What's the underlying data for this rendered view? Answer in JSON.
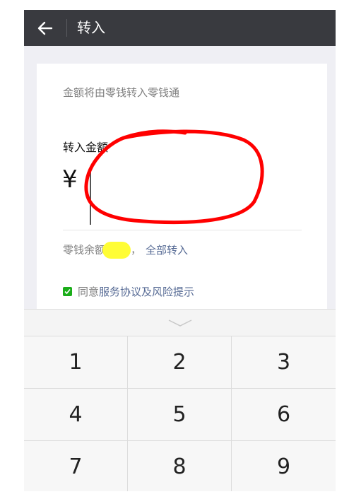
{
  "header": {
    "title": "转入"
  },
  "card": {
    "hint": "金额将由零钱转入零钱通",
    "amount_label": "转入金额",
    "currency_symbol": "¥",
    "amount_value": "",
    "balance_label": "零钱余额",
    "balance_suffix": "，",
    "transfer_all": "全部转入",
    "agree_prefix": "同意",
    "agree_link": "服务协议及风险提示",
    "agree_checked": true
  },
  "keyboard": {
    "keys": [
      "1",
      "2",
      "3",
      "4",
      "5",
      "6",
      "7",
      "8",
      "9"
    ]
  },
  "colors": {
    "header_bg": "#393a3f",
    "link": "#576b95",
    "check": "#1aad19",
    "annotation_red": "#ff0000",
    "highlight_yellow": "#fffd35"
  }
}
